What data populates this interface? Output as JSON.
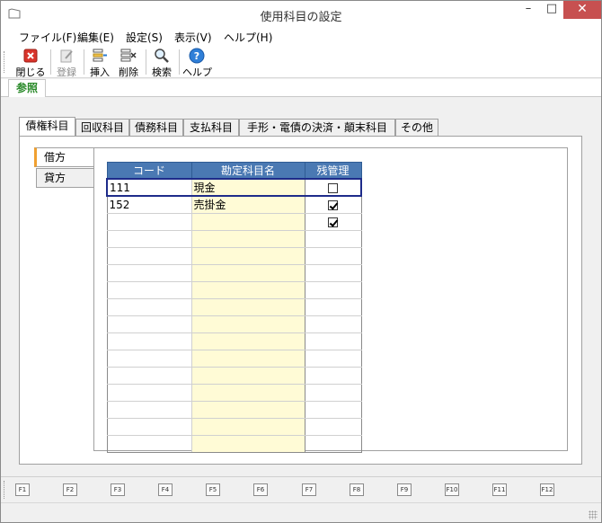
{
  "window": {
    "title": "使用科目の設定",
    "controls": {
      "minimize": "–",
      "maximize": "□",
      "close": "✕"
    }
  },
  "menu": [
    "ファイル(F)",
    "編集(E)",
    "設定(S)",
    "表示(V)",
    "ヘルプ(H)"
  ],
  "toolbar": {
    "close": "閉じる",
    "register": "登録",
    "insert": "挿入",
    "delete": "削除",
    "search": "検索",
    "help": "ヘルプ"
  },
  "reference_tab": "参照",
  "main_tabs": [
    "債権科目",
    "回収科目",
    "債務科目",
    "支払科目",
    "手形・電債の決済・顛末科目",
    "その他"
  ],
  "active_main_tab": "債権科目",
  "side_tabs": [
    "借方",
    "貸方"
  ],
  "active_side_tab": "借方",
  "grid": {
    "headers": [
      "コード",
      "勘定科目名",
      "残管理"
    ],
    "rows": [
      {
        "code": "111",
        "name": "現金",
        "balance": false
      },
      {
        "code": "152",
        "name": "売掛金",
        "balance": true
      },
      {
        "code": "",
        "name": "",
        "balance": true
      }
    ],
    "empty_rows": 13
  },
  "fkeys": [
    "F1",
    "F2",
    "F3",
    "F4",
    "F5",
    "F6",
    "F7",
    "F8",
    "F9",
    "F10",
    "F11",
    "F12"
  ],
  "colors": {
    "header_bg": "#4a79b3",
    "name_column_bg": "#fffbd6",
    "close_button": "#c75050",
    "reference_tab_text": "#2a8a2a",
    "active_side_tab_accent": "#f0a030"
  }
}
